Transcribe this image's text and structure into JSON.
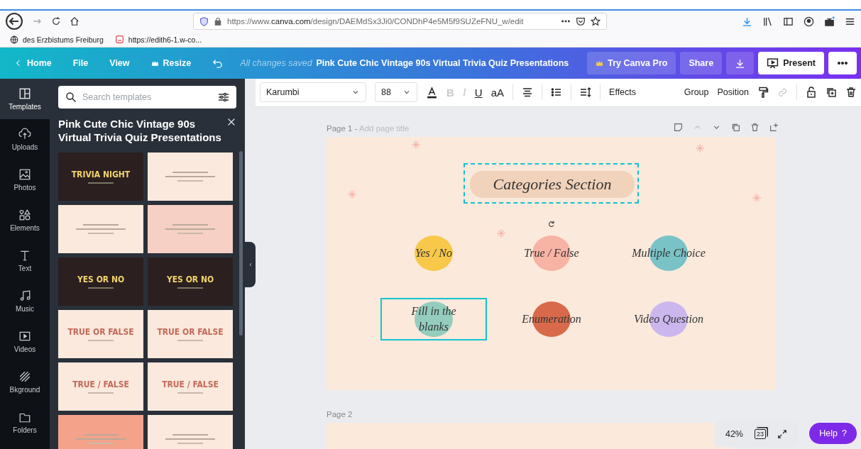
{
  "browser": {
    "url_prefix": "https://www.",
    "url_domain": "canva.com",
    "url_path": "/design/DAEMdSx3Ji0/CONDhP4e5M5f9SUZeFNU_w/edit",
    "bookmarks": [
      "des Erzbistums Freiburg",
      "https://edith6-1.w-co..."
    ]
  },
  "header": {
    "home": "Home",
    "menu": [
      "File",
      "View"
    ],
    "resize": "Resize",
    "status": "All changes saved",
    "title": "Pink Cute Chic Vintage 90s Virtual Trivia Quiz Presentations",
    "pro_button": "Try Canva Pro",
    "share_button": "Share",
    "present_button": "Present"
  },
  "rail": [
    {
      "label": "Templates",
      "selected": true
    },
    {
      "label": "Uploads",
      "selected": false
    },
    {
      "label": "Photos",
      "selected": false
    },
    {
      "label": "Elements",
      "selected": false
    },
    {
      "label": "Text",
      "selected": false
    },
    {
      "label": "Music",
      "selected": false
    },
    {
      "label": "Videos",
      "selected": false
    },
    {
      "label": "Bkground",
      "selected": false
    },
    {
      "label": "Folders",
      "selected": false
    }
  ],
  "panel": {
    "search_placeholder": "Search templates",
    "title": "Pink Cute Chic Vintage 90s Virtual Trivia Quiz Presentations",
    "templates": [
      {
        "kind": "dark",
        "heading": "TRIVIA NIGHT"
      },
      {
        "kind": "cream"
      },
      {
        "kind": "cream"
      },
      {
        "kind": "pink"
      },
      {
        "kind": "dark",
        "heading": "YES OR NO"
      },
      {
        "kind": "dark",
        "heading": "YES OR NO"
      },
      {
        "kind": "cream",
        "heading": "TRUE OR FALSE"
      },
      {
        "kind": "cream",
        "heading": "TRUE OR FALSE"
      },
      {
        "kind": "cream",
        "heading": "TRUE / FALSE"
      },
      {
        "kind": "cream",
        "heading": "TRUE / FALSE"
      },
      {
        "kind": "coral"
      },
      {
        "kind": "cream"
      }
    ]
  },
  "toolbar": {
    "font": "Karumbi",
    "size": "88",
    "text_styles": [
      {
        "label": "B",
        "disabled": true
      },
      {
        "label": "I",
        "disabled": true
      },
      {
        "label": "U",
        "disabled": false
      },
      {
        "label": "aA",
        "disabled": false
      }
    ],
    "effects": "Effects",
    "group": "Group",
    "position": "Position"
  },
  "pages": [
    {
      "label": "Page 1 -",
      "title_placeholder": "Add page title"
    },
    {
      "label": "Page 2"
    }
  ],
  "slide": {
    "title": "Categories Section",
    "categories": [
      {
        "label": "Yes / No",
        "color": "#f8c84a",
        "selected": false
      },
      {
        "label": "True / False",
        "color": "#f7b3a4",
        "selected": false
      },
      {
        "label": "Multiple Choice",
        "color": "#79c3c7",
        "selected": false
      },
      {
        "label": "Fill in the blanks",
        "color": "#94cdbe",
        "selected": true
      },
      {
        "label": "Enumeration",
        "color": "#d86a4b",
        "selected": false
      },
      {
        "label": "Video Question",
        "color": "#cbb6ee",
        "selected": false
      }
    ]
  },
  "footer": {
    "zoom": "42%",
    "page_count": "23",
    "help": "Help",
    "help_mark": "?"
  }
}
